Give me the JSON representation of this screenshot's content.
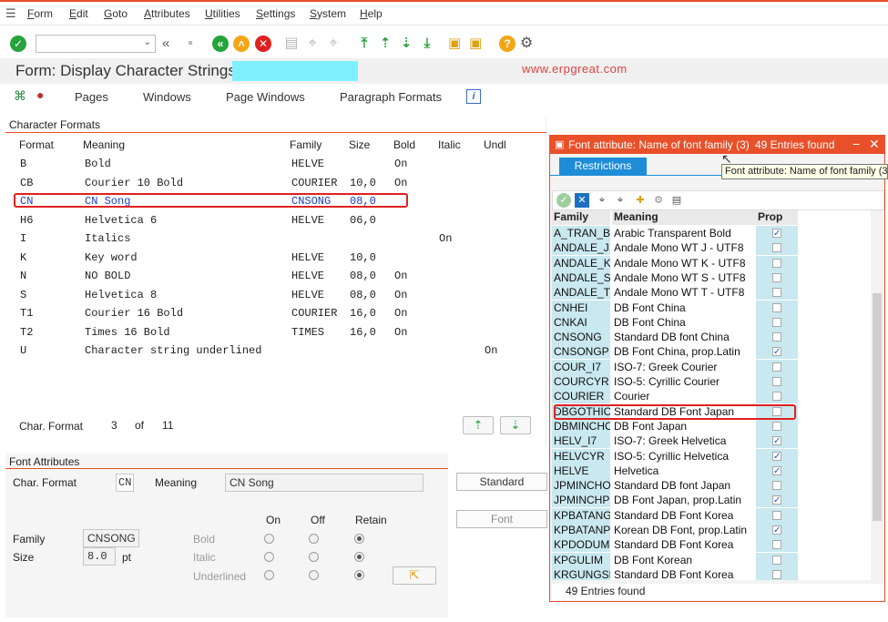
{
  "menu": [
    "Form",
    "Edit",
    "Goto",
    "Attributes",
    "Utilities",
    "Settings",
    "System",
    "Help"
  ],
  "title": "Form: Display Character Strings:",
  "watermark": "www.erpgreat.com",
  "app_toolbar": {
    "pages": "Pages",
    "windows": "Windows",
    "page_windows": "Page Windows",
    "paragraph_formats": "Paragraph Formats"
  },
  "char_formats": {
    "title": "Character Formats",
    "headers": [
      "Format",
      "Meaning",
      "Family",
      "Size",
      "Bold",
      "Italic",
      "Undl"
    ],
    "rows": [
      {
        "format": "B",
        "meaning": "Bold",
        "family": "HELVE",
        "size": "",
        "bold": "On",
        "italic": "",
        "undl": ""
      },
      {
        "format": "CB",
        "meaning": "Courier 10 Bold",
        "family": "COURIER",
        "size": "10,0",
        "bold": "On",
        "italic": "",
        "undl": ""
      },
      {
        "format": "CN",
        "meaning": "CN Song",
        "family": "CNSONG",
        "size": "08,0",
        "bold": "",
        "italic": "",
        "undl": ""
      },
      {
        "format": "H6",
        "meaning": "Helvetica 6",
        "family": "HELVE",
        "size": "06,0",
        "bold": "",
        "italic": "",
        "undl": ""
      },
      {
        "format": "I",
        "meaning": "Italics",
        "family": "",
        "size": "",
        "bold": "",
        "italic": "On",
        "undl": ""
      },
      {
        "format": "K",
        "meaning": "Key word",
        "family": "HELVE",
        "size": "10,0",
        "bold": "",
        "italic": "",
        "undl": ""
      },
      {
        "format": "N",
        "meaning": "NO BOLD",
        "family": "HELVE",
        "size": "08,0",
        "bold": "On",
        "italic": "",
        "undl": ""
      },
      {
        "format": "S",
        "meaning": "Helvetica 8",
        "family": "HELVE",
        "size": "08,0",
        "bold": "On",
        "italic": "",
        "undl": ""
      },
      {
        "format": "T1",
        "meaning": "Courier 16 Bold",
        "family": "COURIER",
        "size": "16,0",
        "bold": "On",
        "italic": "",
        "undl": ""
      },
      {
        "format": "T2",
        "meaning": "Times 16 Bold",
        "family": "TIMES",
        "size": "16,0",
        "bold": "On",
        "italic": "",
        "undl": ""
      },
      {
        "format": "U",
        "meaning": "Character string underlined",
        "family": "",
        "size": "",
        "bold": "",
        "italic": "",
        "undl": "On"
      }
    ],
    "footer_label": "Char. Format",
    "footer_pos": "3",
    "footer_of": "of",
    "footer_total": "11"
  },
  "font_attributes": {
    "title": "Font Attributes",
    "char_format_label": "Char. Format",
    "char_format_value": "CN",
    "meaning_label": "Meaning",
    "meaning_value": "CN Song",
    "family_label": "Family",
    "family_value": "CNSONG",
    "size_label": "Size",
    "size_value": "8.0",
    "size_unit": "pt",
    "col_on": "On",
    "col_off": "Off",
    "col_retain": "Retain",
    "bold_label": "Bold",
    "italic_label": "Italic",
    "underlined_label": "Underlined",
    "standard_button": "Standard",
    "font_button": "Font"
  },
  "popup": {
    "title": "Font attribute: Name of font family (3)",
    "entries_header": "49 Entries found",
    "tab": "Restrictions",
    "tooltip": "Font attribute: Name of font family (3",
    "col_family": "Family",
    "col_meaning": "Meaning",
    "col_prop": "Prop",
    "rows": [
      {
        "family": "A_TRAN_B",
        "meaning": "Arabic Transparent Bold",
        "prop": true
      },
      {
        "family": "ANDALE_J",
        "meaning": "Andale Mono WT J - UTF8",
        "prop": false
      },
      {
        "family": "ANDALE_K",
        "meaning": "Andale Mono WT K - UTF8",
        "prop": false
      },
      {
        "family": "ANDALE_S",
        "meaning": "Andale Mono WT S - UTF8",
        "prop": false
      },
      {
        "family": "ANDALE_T",
        "meaning": "Andale Mono WT T - UTF8",
        "prop": false
      },
      {
        "family": "CNHEI",
        "meaning": "DB Font China",
        "prop": false
      },
      {
        "family": "CNKAI",
        "meaning": "DB Font China",
        "prop": false
      },
      {
        "family": "CNSONG",
        "meaning": "Standard DB font China",
        "prop": false
      },
      {
        "family": "CNSONGP",
        "meaning": "DB Font China, prop.Latin",
        "prop": true
      },
      {
        "family": "COUR_I7",
        "meaning": "ISO-7: Greek Courier",
        "prop": false
      },
      {
        "family": "COURCYR",
        "meaning": "ISO-5: Cyrillic Courier",
        "prop": false
      },
      {
        "family": "COURIER",
        "meaning": "Courier",
        "prop": false
      },
      {
        "family": "DBGOTHIC",
        "meaning": "Standard DB Font Japan",
        "prop": false
      },
      {
        "family": "DBMINCHO",
        "meaning": "DB Font Japan",
        "prop": false
      },
      {
        "family": "HELV_I7",
        "meaning": "ISO-7: Greek Helvetica",
        "prop": true
      },
      {
        "family": "HELVCYR",
        "meaning": "ISO-5: Cyrillic Helvetica",
        "prop": true
      },
      {
        "family": "HELVE",
        "meaning": "Helvetica",
        "prop": true
      },
      {
        "family": "JPMINCHO",
        "meaning": "Standard DB font Japan",
        "prop": false
      },
      {
        "family": "JPMINCHP",
        "meaning": "DB Font Japan, prop.Latin",
        "prop": true
      },
      {
        "family": "KPBATANG",
        "meaning": "Standard DB Font Korea",
        "prop": false
      },
      {
        "family": "KPBATANP",
        "meaning": "Korean DB Font, prop.Latin",
        "prop": true
      },
      {
        "family": "KPDODUM",
        "meaning": "Standard DB Font Korea",
        "prop": false
      },
      {
        "family": "KPGULIM",
        "meaning": "DB Font Korean",
        "prop": false
      },
      {
        "family": "KRGUNGSE",
        "meaning": "Standard DB Font Korea",
        "prop": false
      }
    ],
    "footer": "49 Entries found"
  },
  "colors": {
    "accent": "#e8502a",
    "tab_blue": "#1d8dd8",
    "highlight_red": "#e02020",
    "key_column": "#c9e8ef"
  }
}
